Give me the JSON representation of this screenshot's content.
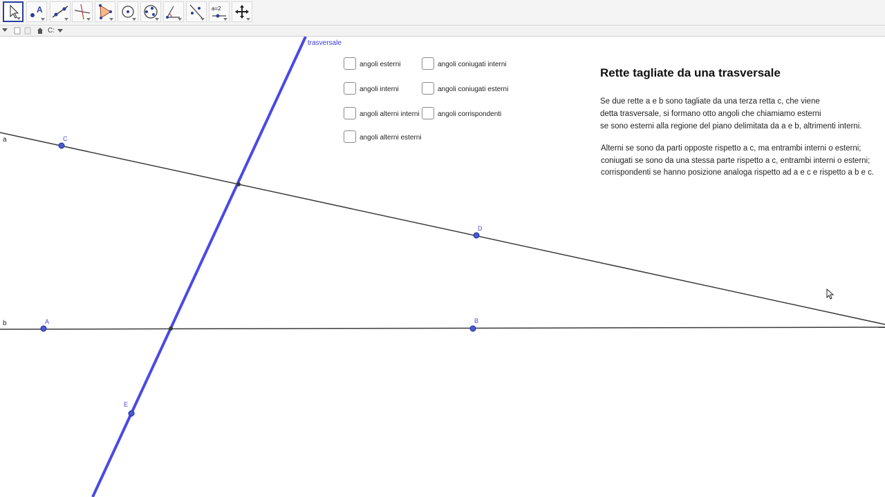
{
  "toolbar": {
    "tools": [
      {
        "name": "move-tool-button",
        "icon": "arrow-cursor-icon",
        "active": true
      },
      {
        "name": "point-tool-button",
        "icon": "point-A-icon"
      },
      {
        "name": "line-tool-button",
        "icon": "line-icon"
      },
      {
        "name": "perpendicular-tool-button",
        "icon": "perpendicular-line-icon"
      },
      {
        "name": "polygon-tool-button",
        "icon": "polygon-icon"
      },
      {
        "name": "circle-tool-button",
        "icon": "circle-center-icon"
      },
      {
        "name": "ellipse-tool-button",
        "icon": "ellipse-icon"
      },
      {
        "name": "angle-tool-button",
        "icon": "angle-icon"
      },
      {
        "name": "reflect-tool-button",
        "icon": "reflect-icon"
      },
      {
        "name": "slider-tool-button",
        "icon": "slider-icon",
        "label": "a=2"
      },
      {
        "name": "move-view-tool-button",
        "icon": "move-graphics-view-icon"
      }
    ]
  },
  "subbar": {
    "drive_label": "C:"
  },
  "canvas": {
    "line_labels": {
      "a": "a",
      "b": "b",
      "transversal": "trasversale"
    },
    "points": {
      "A": "A",
      "B": "B",
      "C": "C",
      "D": "D",
      "E": "E"
    },
    "checkboxes": [
      {
        "label": "angoli esterni",
        "checked": false
      },
      {
        "label": "angoli interni",
        "checked": false
      },
      {
        "label": "angoli alterni interni",
        "checked": false
      },
      {
        "label": "angoli alterni esterni",
        "checked": false
      },
      {
        "label": "angoli coniugati interni",
        "checked": false
      },
      {
        "label": "angoli coniugati esterni",
        "checked": false
      },
      {
        "label": "angoli corrispondenti",
        "checked": false
      }
    ],
    "title": "Rette tagliate da una trasversale",
    "paragraph1": [
      "Se due rette a e b sono tagliate da una terza retta c, che viene",
      "detta trasversale, si formano otto angoli che chiamiamo esterni",
      "se sono esterni alla regione del piano delimitata da a e b, altrimenti interni."
    ],
    "paragraph2": [
      "Alterni se sono da parti opposte rispetto a c, ma entrambi interni o esterni;",
      "coniugati se sono da una stessa parte rispetto a c, entrambi interni o esterni;",
      "corrispondenti se hanno posizione analoga rispetto ad a e c e rispetto a b e c."
    ]
  },
  "colors": {
    "transversal": "#4a4ae6",
    "line": "#3a3a3a",
    "point": "#4a5ad6",
    "point_label": "#4a4ad0",
    "active_tool_border": "#2a3f9c"
  }
}
